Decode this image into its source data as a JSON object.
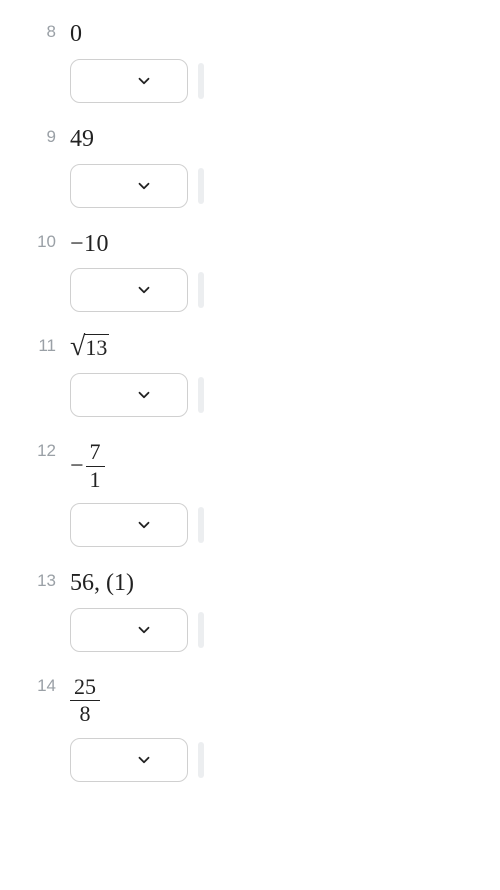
{
  "questions": [
    {
      "number": "8",
      "type": "plain",
      "value": "0"
    },
    {
      "number": "9",
      "type": "plain",
      "value": "49"
    },
    {
      "number": "10",
      "type": "neg",
      "value": "10"
    },
    {
      "number": "11",
      "type": "sqrt",
      "radicand": "13"
    },
    {
      "number": "12",
      "type": "negfrac",
      "num": "7",
      "den": "1"
    },
    {
      "number": "13",
      "type": "plain",
      "value": "56, (1)"
    },
    {
      "number": "14",
      "type": "frac",
      "num": "25",
      "den": "8"
    }
  ],
  "symbols": {
    "minus": "−",
    "surd": "√"
  }
}
